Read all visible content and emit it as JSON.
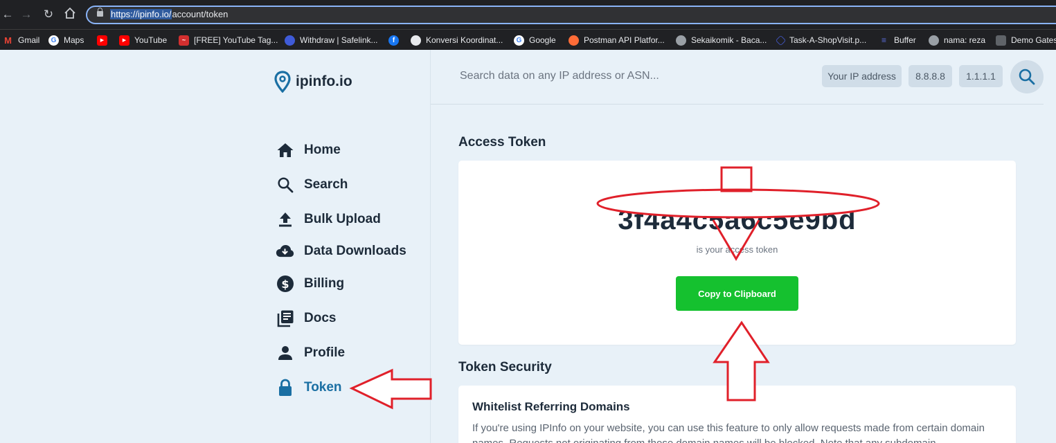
{
  "browser": {
    "url_host": "https://ipinfo.io/",
    "url_path": "account/token",
    "bookmarks": [
      {
        "label": "Gmail",
        "icon": "gmail-icon"
      },
      {
        "label": "Maps",
        "icon": "google-icon"
      },
      {
        "label": "",
        "icon": "youtube-icon"
      },
      {
        "label": "YouTube",
        "icon": "youtube-icon"
      },
      {
        "label": "[FREE] YouTube Tag...",
        "icon": "tag-icon"
      },
      {
        "label": "Withdraw | Safelink...",
        "icon": "safelink-icon"
      },
      {
        "label": "",
        "icon": "facebook-icon"
      },
      {
        "label": "Konversi Koordinat...",
        "icon": "globe-icon"
      },
      {
        "label": "Google",
        "icon": "google-icon"
      },
      {
        "label": "Postman API Platfor...",
        "icon": "postman-icon"
      },
      {
        "label": "Sekaikomik - Baca...",
        "icon": "globe-icon"
      },
      {
        "label": "Task-A-ShopVisit.p...",
        "icon": "task-icon"
      },
      {
        "label": "Buffer",
        "icon": "buffer-icon"
      },
      {
        "label": "nama: reza",
        "icon": "globe-icon"
      },
      {
        "label": "Demo Gates",
        "icon": "calendar-icon"
      }
    ]
  },
  "header": {
    "logo_text": "ipinfo.io",
    "search_placeholder": "Search data on any IP address or ASN...",
    "chips": [
      "Your IP address",
      "8.8.8.8",
      "1.1.1.1"
    ]
  },
  "sidebar": {
    "items": [
      {
        "label": "Home",
        "icon": "home-icon"
      },
      {
        "label": "Search",
        "icon": "search-icon"
      },
      {
        "label": "Bulk Upload",
        "icon": "upload-icon"
      },
      {
        "label": "Data Downloads",
        "icon": "cloud-download-icon"
      },
      {
        "label": "Billing",
        "icon": "dollar-icon"
      },
      {
        "label": "Docs",
        "icon": "docs-icon"
      },
      {
        "label": "Profile",
        "icon": "person-icon"
      },
      {
        "label": "Token",
        "icon": "lock-icon",
        "active": true
      }
    ]
  },
  "main": {
    "access_token_title": "Access Token",
    "token_value": "3f4a4c5a6c5e9bd",
    "token_caption": "is your access token",
    "copy_button": "Copy to Clipboard",
    "token_security_title": "Token Security",
    "whitelist_title": "Whitelist Referring Domains",
    "whitelist_body": "If you're using IPInfo on your website, you can use this feature to only allow requests made from certain domain names. Requests not originating from those domain names will be blocked. Note that any subdomain"
  },
  "colors": {
    "accent_blue": "#1a6fa3",
    "button_green": "#15c12f",
    "annotation_red": "#e0202a",
    "page_bg": "#e8f1f8"
  }
}
